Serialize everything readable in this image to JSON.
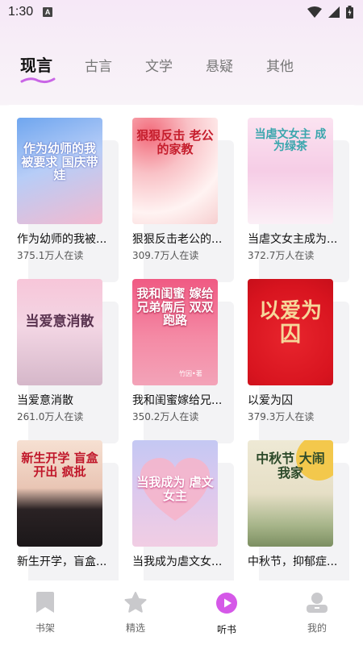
{
  "status": {
    "time": "1:30",
    "badge": "A"
  },
  "tabs": [
    {
      "label": "现言"
    },
    {
      "label": "古言"
    },
    {
      "label": "文学"
    },
    {
      "label": "悬疑"
    },
    {
      "label": "其他"
    }
  ],
  "books": [
    {
      "title": "作为幼师的我被...",
      "readers": "375.1万人在读",
      "cover_text": "作为幼师的我 被要求 国庆带娃"
    },
    {
      "title": "狠狠反击老公的...",
      "readers": "309.7万人在读",
      "cover_text": "狠狠反击 老公的家教"
    },
    {
      "title": "当虐文女主成为...",
      "readers": "372.7万人在读",
      "cover_text": "当虐文女主 成为绿茶"
    },
    {
      "title": "当爱意消散",
      "readers": "261.0万人在读",
      "cover_text": "当爱意消散"
    },
    {
      "title": "我和闺蜜嫁给兄...",
      "readers": "350.2万人在读",
      "cover_text": "我和闺蜜 嫁给兄弟俩后 双双跑路",
      "cover_author": "竹因•著"
    },
    {
      "title": "以爱为囚",
      "readers": "379.3万人在读",
      "cover_text": "以爱为囚"
    },
    {
      "title": "新生开学，盲盒...",
      "readers": "",
      "cover_text": "新生开学 盲盒开出 疯批"
    },
    {
      "title": "当我成为虐文女...",
      "readers": "",
      "cover_text": "当我成为 虐文女主"
    },
    {
      "title": "中秋节，抑郁症...",
      "readers": "",
      "cover_text": "中秋节 大闹我家"
    }
  ],
  "nav": [
    {
      "label": "书架",
      "icon": "bookmark-icon"
    },
    {
      "label": "精选",
      "icon": "star-icon"
    },
    {
      "label": "听书",
      "icon": "play-icon"
    },
    {
      "label": "我的",
      "icon": "user-icon"
    }
  ],
  "colors": {
    "accent": "#d558e8",
    "tab_underline": "#c965e6"
  }
}
